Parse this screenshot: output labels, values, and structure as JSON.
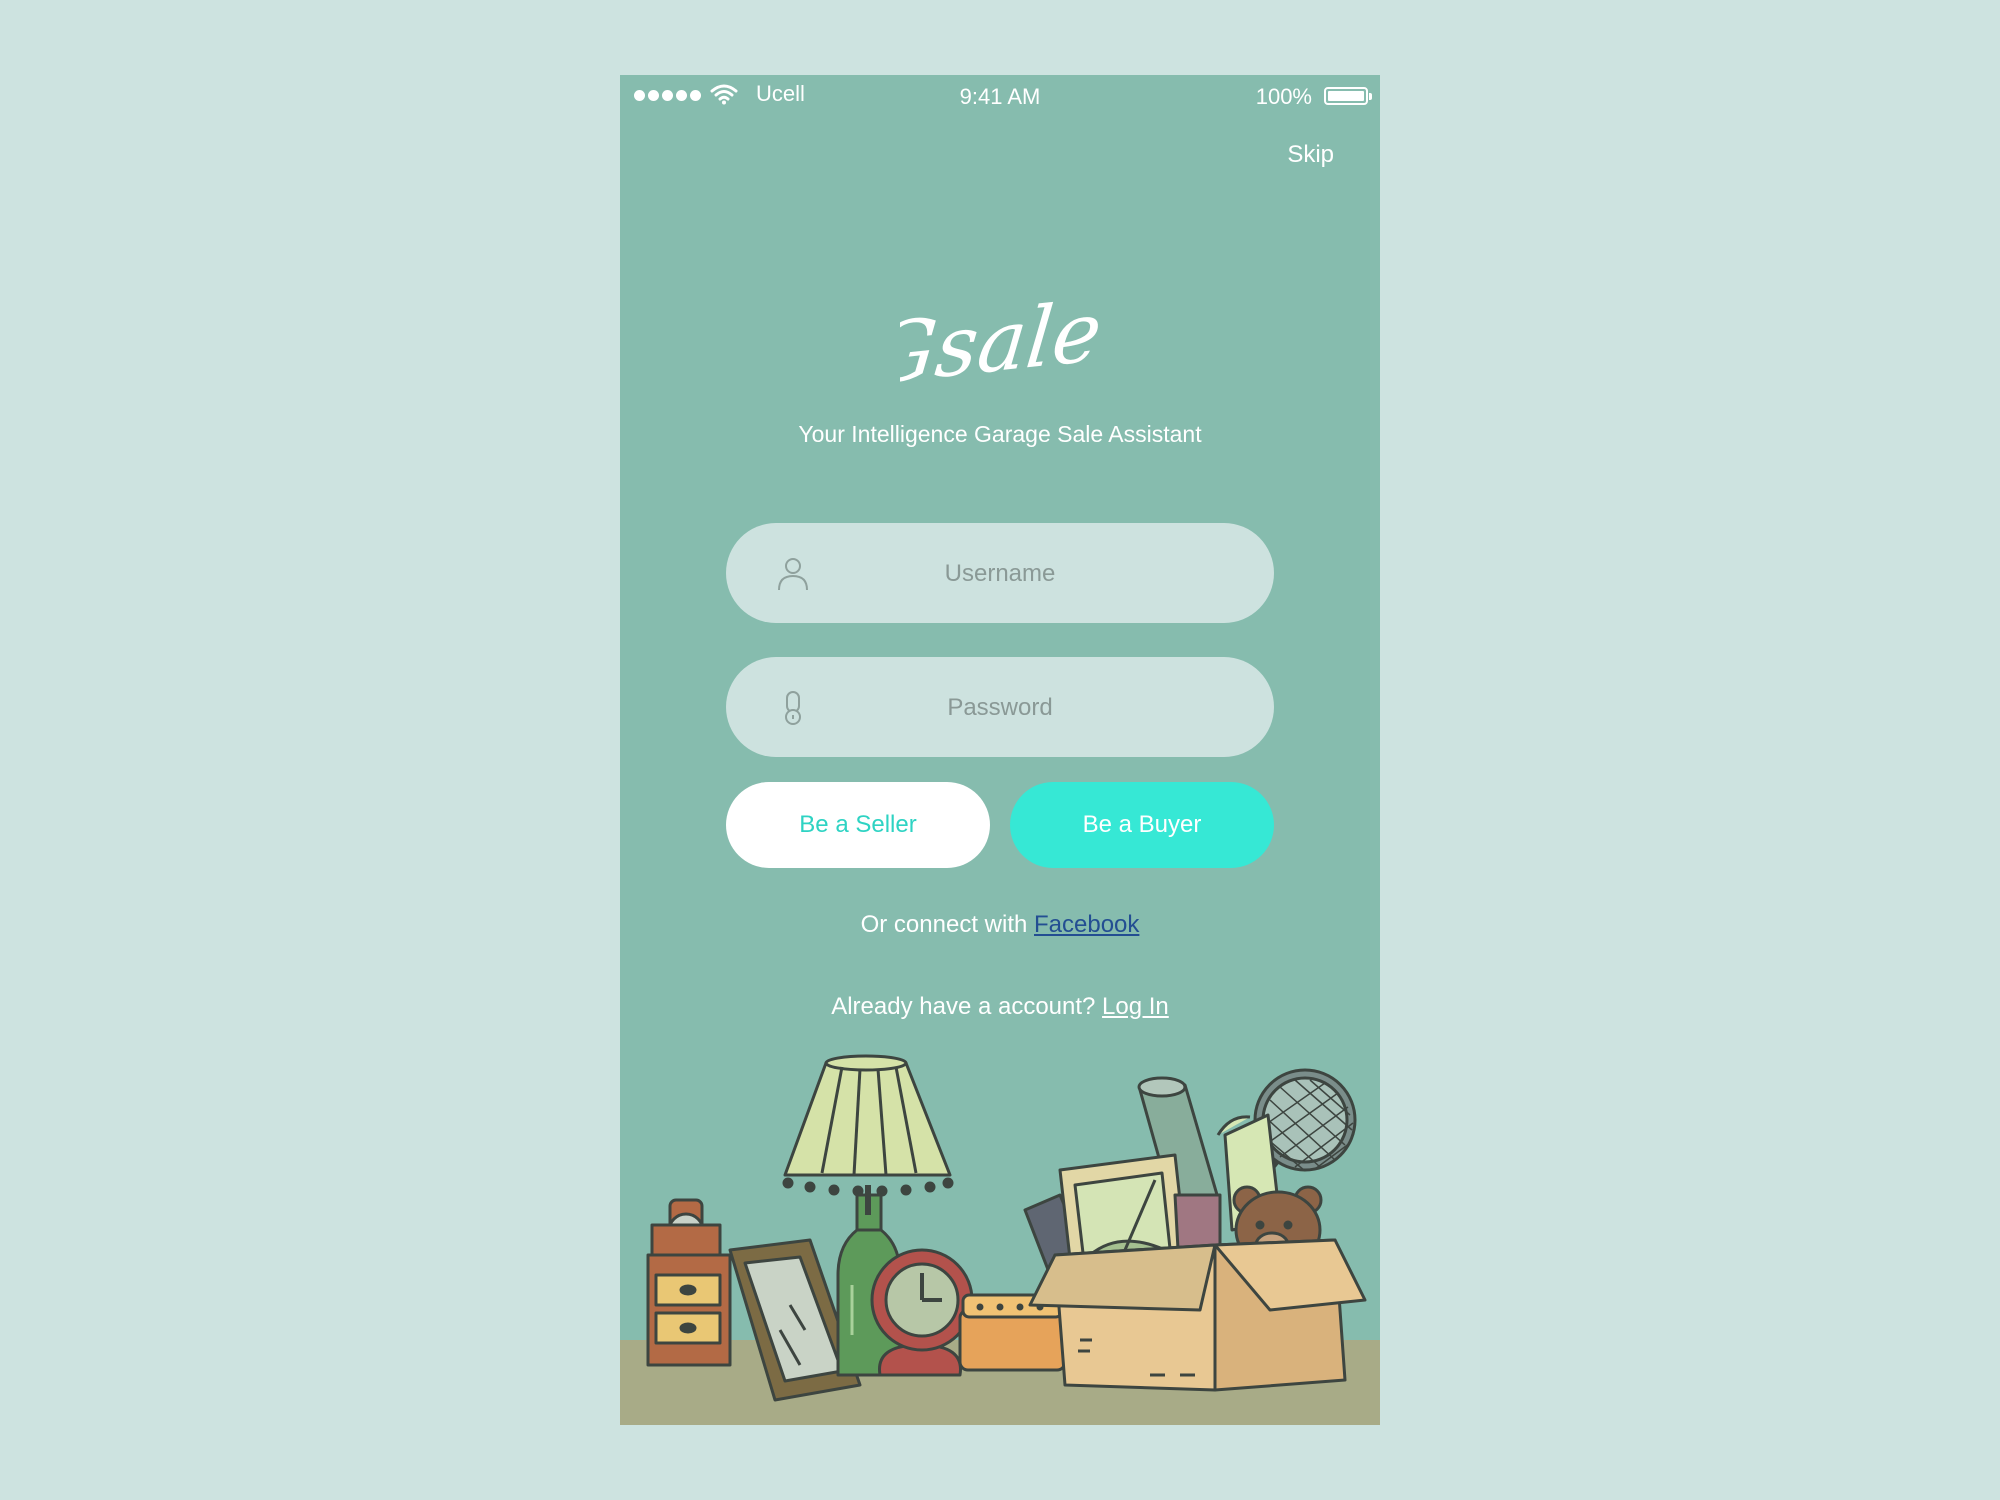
{
  "status_bar": {
    "carrier": "Ucell",
    "time": "9:41 AM",
    "battery": "100%"
  },
  "skip_label": "Skip",
  "app": {
    "logo_text": "Gsale",
    "tagline": "Your Intelligence Garage Sale Assistant"
  },
  "form": {
    "username_placeholder": "Username",
    "password_placeholder": "Password"
  },
  "buttons": {
    "seller": "Be a Seller",
    "buyer": "Be a Buyer"
  },
  "connect": {
    "prefix": "Or connect with ",
    "link": "Facebook"
  },
  "login": {
    "prefix": "Already have a account? ",
    "link": "Log In"
  },
  "colors": {
    "screen_background": "#86bcae",
    "page_background": "#cde3e0",
    "input_background": "#cde2df",
    "buyer_button": "#36e8d5",
    "seller_text": "#2ed3c3",
    "facebook_link": "#234e92"
  }
}
